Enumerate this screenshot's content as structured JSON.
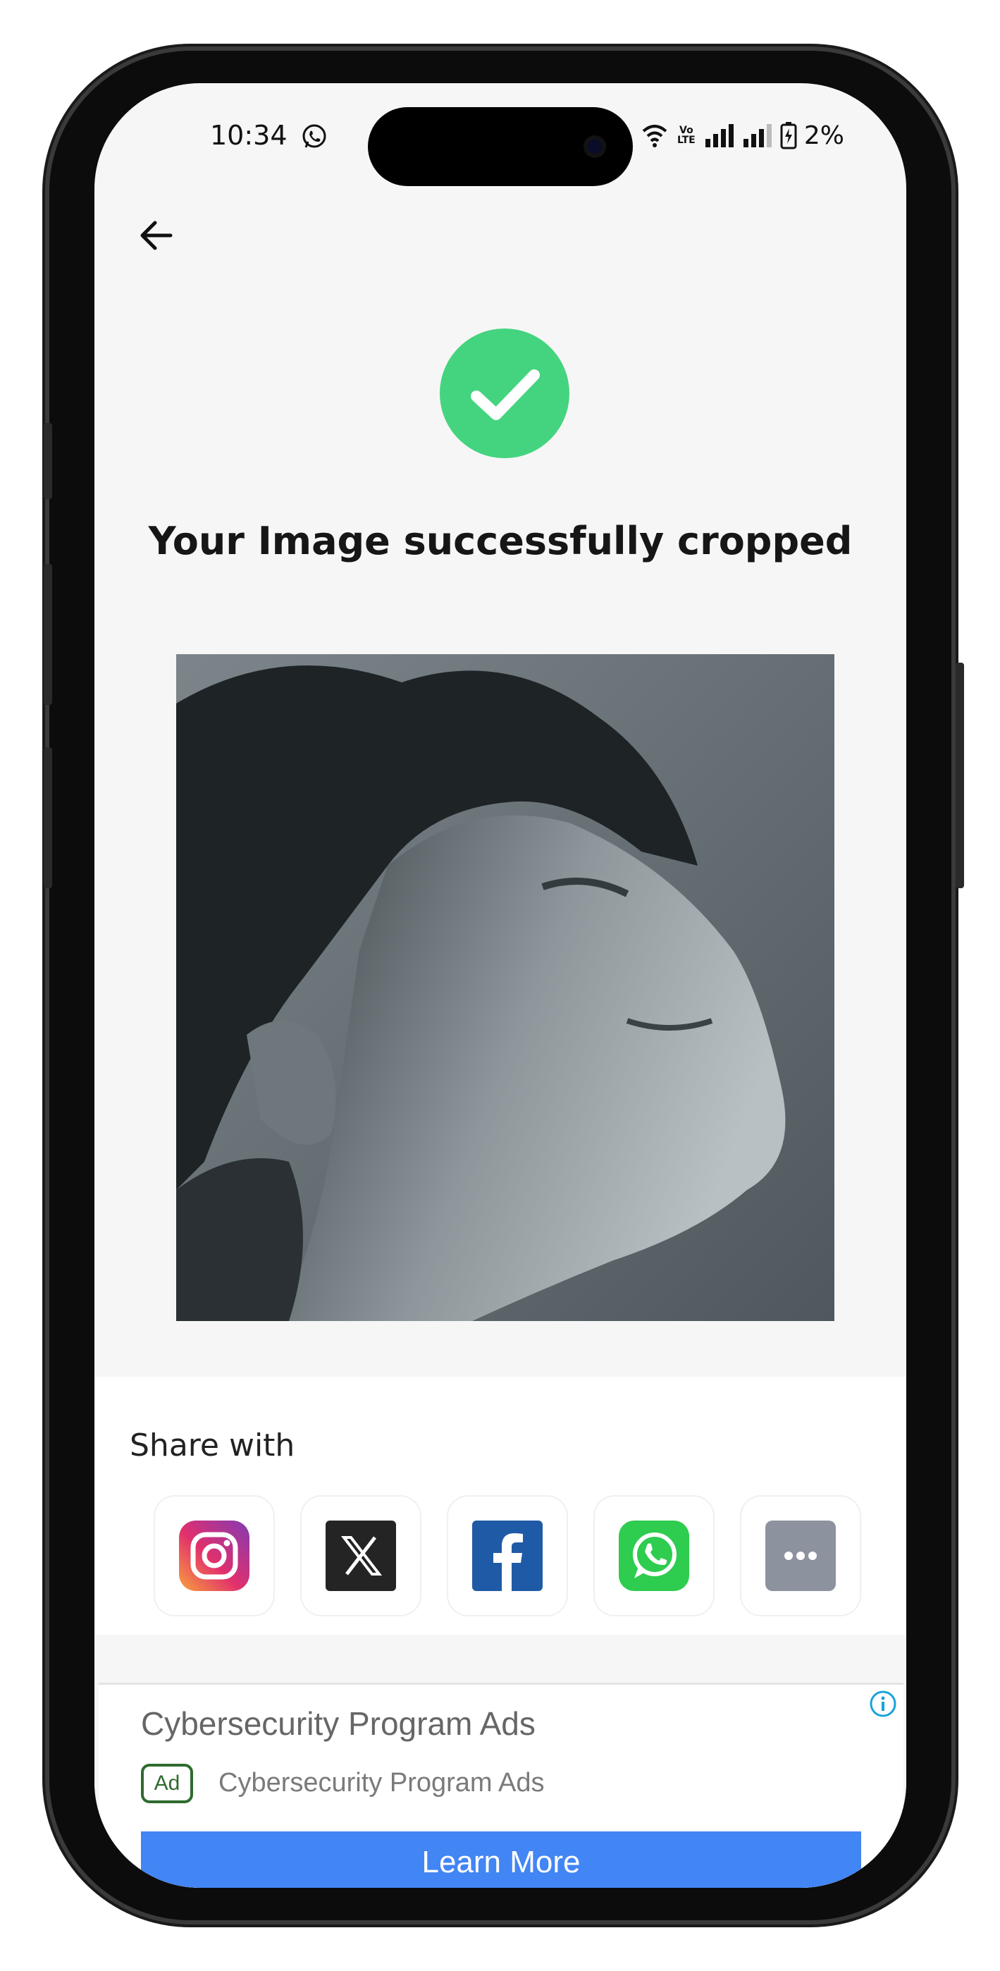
{
  "status_bar": {
    "time": "10:34",
    "network": "Vo LTE",
    "battery": "2%",
    "notification_icon": "whatsapp-icon"
  },
  "header": {
    "back_icon": "back-arrow-icon"
  },
  "result": {
    "badge_icon": "checkmark-icon",
    "badge_color": "#44d47f",
    "title": "Your Image successfully cropped"
  },
  "share": {
    "title": "Share with",
    "targets": [
      {
        "label": "Instagram",
        "icon": "instagram-icon"
      },
      {
        "label": "X",
        "icon": "x-icon"
      },
      {
        "label": "Facebook",
        "icon": "facebook-icon"
      },
      {
        "label": "WhatsApp",
        "icon": "whatsapp-icon"
      },
      {
        "label": "More",
        "icon": "more-icon"
      }
    ]
  },
  "ad": {
    "headline": "Cybersecurity Program Ads",
    "badge": "Ad",
    "advertiser": "Cybersecurity Program Ads",
    "cta": "Learn More",
    "cta_color": "#4285f4",
    "info_icon": "info-icon"
  }
}
